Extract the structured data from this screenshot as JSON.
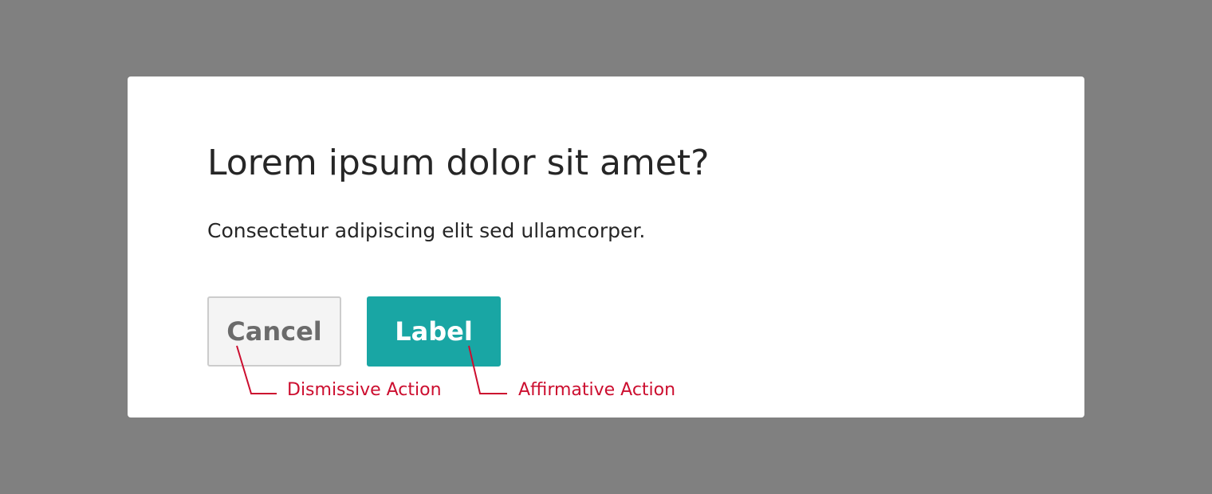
{
  "dialog": {
    "title": "Lorem ipsum dolor sit amet?",
    "message": "Consectetur adipiscing elit sed ullamcorper.",
    "cancel_label": "Cancel",
    "confirm_label": "Label"
  },
  "annotations": {
    "dismissive": "Dismissive Action",
    "affirmative": "Affirmative Action"
  },
  "colors": {
    "backdrop": "#808080",
    "dialog_bg": "#ffffff",
    "primary_button": "#19a6a4",
    "secondary_button_bg": "#f4f4f4",
    "secondary_button_border": "#cccccc",
    "annotation": "#cc0e2f"
  }
}
